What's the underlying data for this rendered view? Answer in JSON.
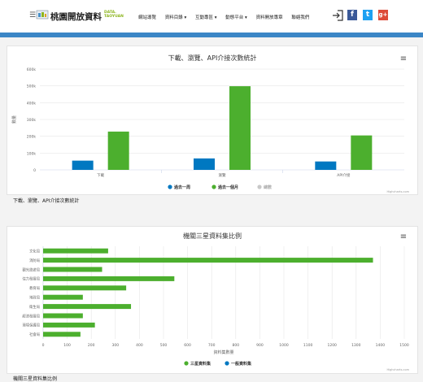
{
  "header": {
    "logo_title": "桃園開放資料",
    "logo_sub_1": "DATA.",
    "logo_sub_2": "TAOYUAN",
    "nav": [
      "網站導覽",
      "資料目錄 ▾",
      "互動專區 ▾",
      "動態平台 ▾",
      "資料開放專章",
      "聯絡我們"
    ]
  },
  "colors": {
    "band": "#3b86c6",
    "blue": "#0078c1",
    "green": "#4caf2e",
    "grey": "#c8c8c8"
  },
  "chart1": {
    "title": "下載、瀏覽、API介接次數統計",
    "ylabel": "數量",
    "credit": "Highcharts.com",
    "caption": "下載、瀏覽、API介接次數統計",
    "menu_icon": "≡"
  },
  "chart2": {
    "title": "機關三星資料集比例",
    "xlabel": "資料集數量",
    "credit": "Highcharts.com",
    "caption": "機關三星資料集比例",
    "menu_icon": "≡"
  },
  "chart_data": [
    {
      "type": "bar",
      "title": "下載、瀏覽、API介接次數統計",
      "ylabel": "數量",
      "xlabel": "",
      "categories": [
        "下載",
        "瀏覽",
        "API介接"
      ],
      "ylim": [
        0,
        600000
      ],
      "yticks": [
        "0",
        "100k",
        "200k",
        "300k",
        "400k",
        "500k",
        "600k"
      ],
      "series": [
        {
          "name": "過去一周",
          "values": [
            55000,
            68000,
            50000
          ]
        },
        {
          "name": "過去一個月",
          "values": [
            228000,
            498000,
            205000
          ]
        },
        {
          "name": "總數",
          "values": [
            0,
            0,
            0
          ]
        }
      ],
      "legend": "bottom-center",
      "grid": true
    },
    {
      "type": "bar",
      "orientation": "horizontal",
      "title": "機關三星資料集比例",
      "xlabel": "資料集數量",
      "categories": [
        "文化局",
        "消防局",
        "觀光旅遊局",
        "住力發展局",
        "教育局",
        "地政局",
        "衛生局",
        "經濟發展局",
        "環境保護局",
        "社會局"
      ],
      "xlim": [
        0,
        1500
      ],
      "xticks": [
        "0",
        "100",
        "200",
        "300",
        "400",
        "500",
        "600",
        "700",
        "800",
        "900",
        "1000",
        "1100",
        "1200",
        "1300",
        "1400",
        "1500"
      ],
      "series": [
        {
          "name": "三星資料集",
          "values": [
            270,
            1370,
            245,
            545,
            345,
            165,
            365,
            165,
            215,
            155
          ]
        },
        {
          "name": "一般資料集",
          "values": [
            0,
            0,
            0,
            0,
            0,
            0,
            0,
            0,
            0,
            0
          ]
        }
      ],
      "legend": "bottom-center",
      "grid": true
    }
  ]
}
